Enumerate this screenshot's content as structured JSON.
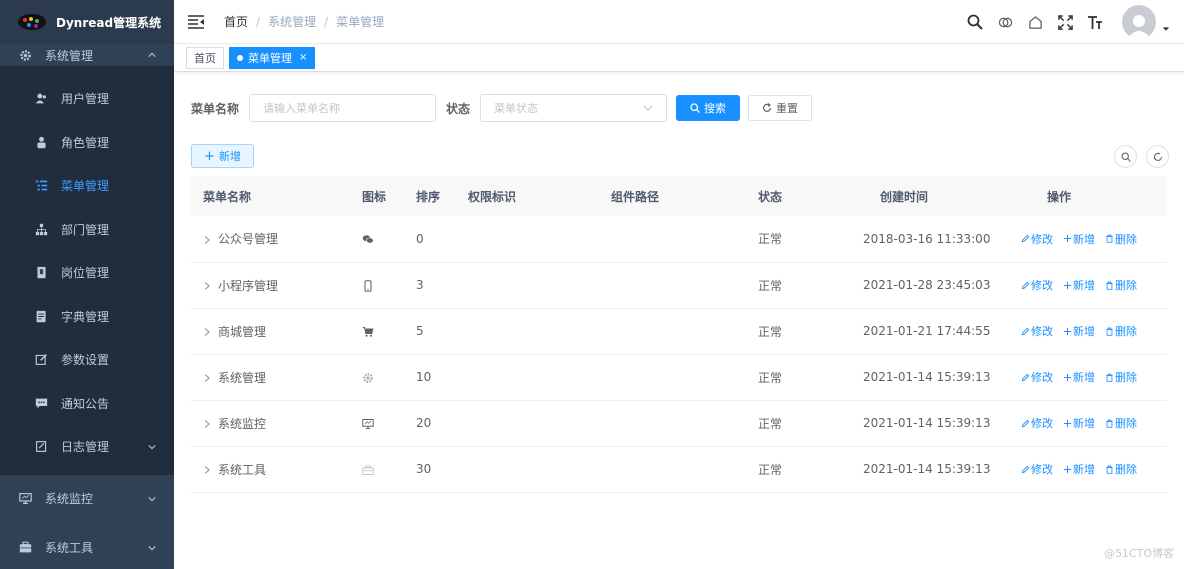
{
  "app": {
    "title": "Dynread管理系统"
  },
  "sidebar": {
    "items": [
      {
        "label": "系统管理",
        "icon": "gear-icon",
        "level": "top",
        "expanded": true
      },
      {
        "label": "用户管理",
        "icon": "user-icon",
        "level": "sub"
      },
      {
        "label": "角色管理",
        "icon": "peoples-icon",
        "level": "sub"
      },
      {
        "label": "菜单管理",
        "icon": "tree-table-icon",
        "level": "sub",
        "active": true
      },
      {
        "label": "部门管理",
        "icon": "tree-icon",
        "level": "sub"
      },
      {
        "label": "岗位管理",
        "icon": "post-icon",
        "level": "sub"
      },
      {
        "label": "字典管理",
        "icon": "dict-icon",
        "level": "sub"
      },
      {
        "label": "参数设置",
        "icon": "edit-icon",
        "level": "sub"
      },
      {
        "label": "通知公告",
        "icon": "message-icon",
        "level": "sub"
      },
      {
        "label": "日志管理",
        "icon": "log-icon",
        "level": "sub"
      },
      {
        "label": "系统监控",
        "icon": "monitor-icon",
        "level": "top"
      },
      {
        "label": "系统工具",
        "icon": "tool-icon",
        "level": "top"
      }
    ]
  },
  "header": {
    "breadcrumb": [
      "首页",
      "系统管理",
      "菜单管理"
    ]
  },
  "tags": {
    "home": "首页",
    "active": "菜单管理",
    "close": "×"
  },
  "search": {
    "name_label": "菜单名称",
    "name_placeholder": "请输入菜单名称",
    "status_label": "状态",
    "status_placeholder": "菜单状态",
    "search_button": "搜索",
    "reset_button": "重置"
  },
  "toolbar": {
    "add_button": "新增"
  },
  "table": {
    "columns": [
      "菜单名称",
      "图标",
      "排序",
      "权限标识",
      "组件路径",
      "状态",
      "创建时间",
      "操作"
    ],
    "actions": {
      "edit": "修改",
      "add": "新增",
      "delete": "删除"
    },
    "rows": [
      {
        "name": "公众号管理",
        "icon": "wechat-icon",
        "order": "0",
        "status": "正常",
        "created": "2018-03-16 11:33:00"
      },
      {
        "name": "小程序管理",
        "icon": "phone-icon",
        "order": "3",
        "status": "正常",
        "created": "2021-01-28 23:45:03"
      },
      {
        "name": "商城管理",
        "icon": "cart-icon",
        "order": "5",
        "status": "正常",
        "created": "2021-01-21 17:44:55"
      },
      {
        "name": "系统管理",
        "icon": "gear-icon",
        "order": "10",
        "status": "正常",
        "created": "2021-01-14 15:39:13"
      },
      {
        "name": "系统监控",
        "icon": "monitor-icon",
        "order": "20",
        "status": "正常",
        "created": "2021-01-14 15:39:13"
      },
      {
        "name": "系统工具",
        "icon": "toolbox-icon",
        "order": "30",
        "status": "正常",
        "created": "2021-01-14 15:39:13"
      }
    ]
  },
  "watermark": "@51CTO博客",
  "colors": {
    "sidebar_bg": "#304156",
    "primary": "#1890ff",
    "menu_active": "#409eff"
  }
}
